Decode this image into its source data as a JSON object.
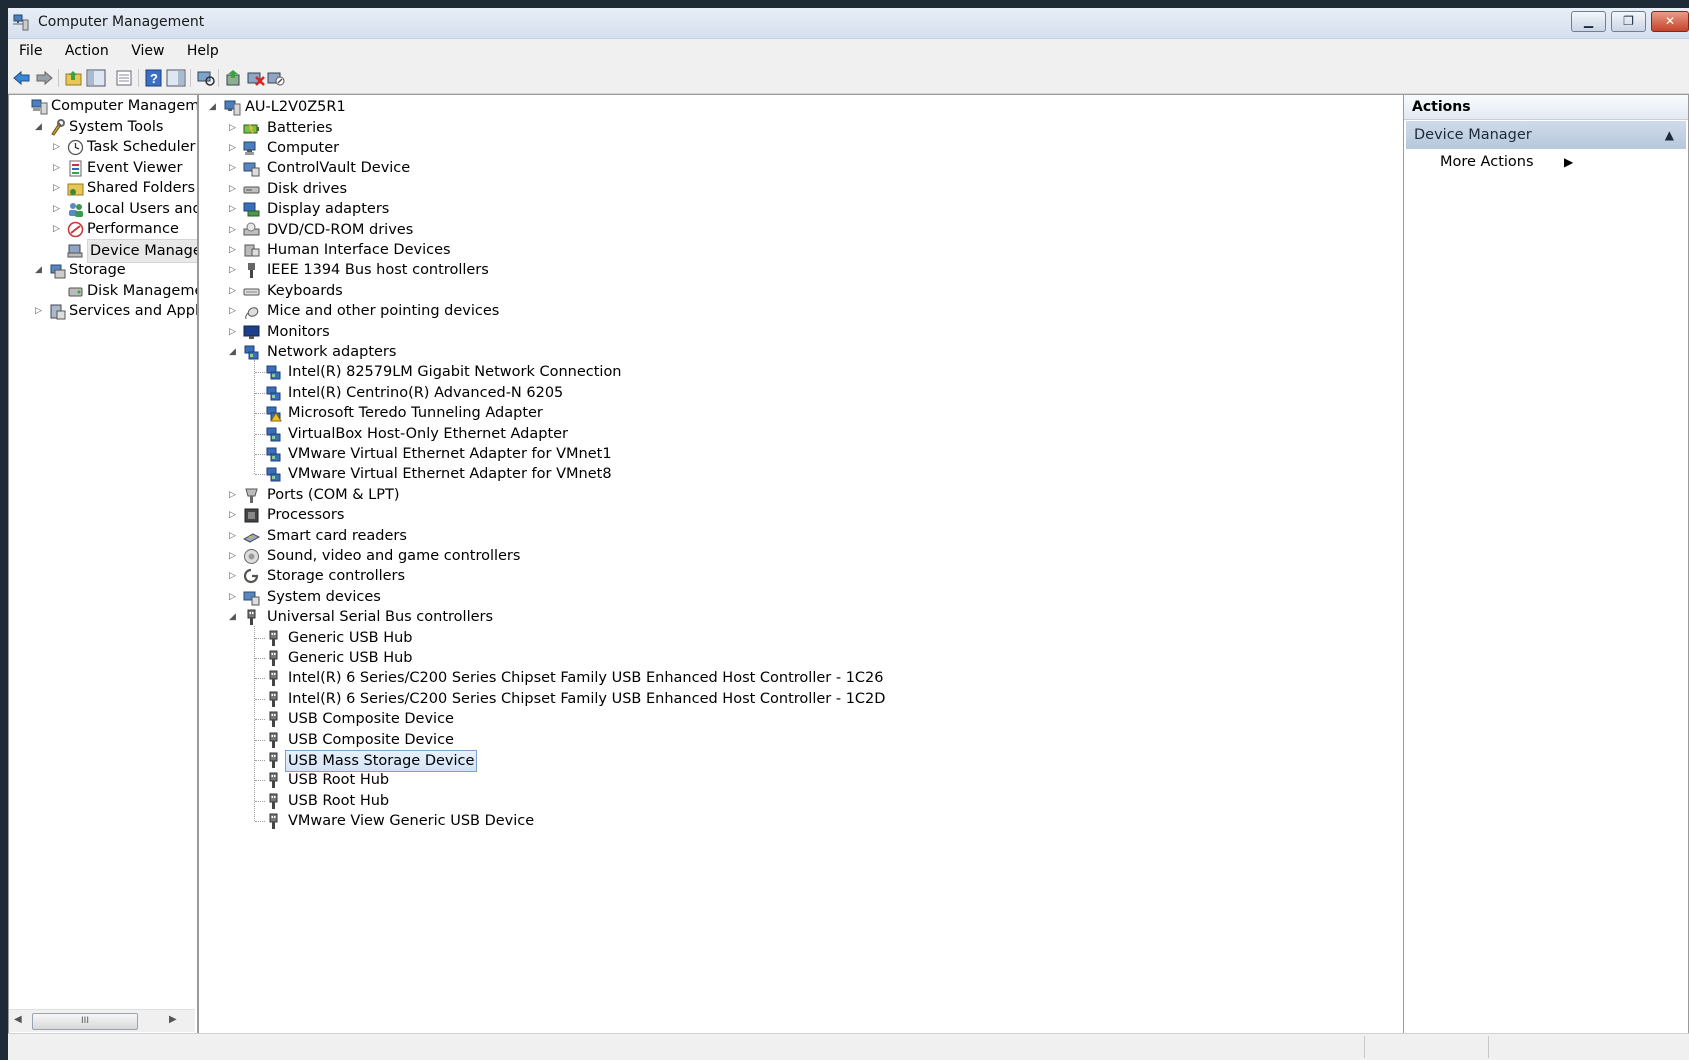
{
  "window": {
    "title": "Computer Management"
  },
  "caption_buttons": {
    "minimize": "▁",
    "restore": "❐",
    "close": "✕"
  },
  "menu": [
    "File",
    "Action",
    "View",
    "Help"
  ],
  "left_tree": [
    {
      "label": "Computer Management",
      "icon": "computer-management-icon",
      "level": 0,
      "expander": ""
    },
    {
      "label": "System Tools",
      "icon": "system-tools-icon",
      "level": 1,
      "expander": "◢"
    },
    {
      "label": "Task Scheduler",
      "icon": "clock-icon",
      "level": 2,
      "expander": "▷"
    },
    {
      "label": "Event Viewer",
      "icon": "event-viewer-icon",
      "level": 2,
      "expander": "▷"
    },
    {
      "label": "Shared Folders",
      "icon": "shared-folders-icon",
      "level": 2,
      "expander": "▷"
    },
    {
      "label": "Local Users and Gro",
      "icon": "users-icon",
      "level": 2,
      "expander": "▷"
    },
    {
      "label": "Performance",
      "icon": "performance-icon",
      "level": 2,
      "expander": "▷"
    },
    {
      "label": "Device Manager",
      "icon": "device-manager-icon",
      "level": 2,
      "expander": "",
      "selected": true
    },
    {
      "label": "Storage",
      "icon": "storage-icon",
      "level": 1,
      "expander": "◢"
    },
    {
      "label": "Disk Management",
      "icon": "disk-management-icon",
      "level": 2,
      "expander": ""
    },
    {
      "label": "Services and Applicat",
      "icon": "services-icon",
      "level": 1,
      "expander": "▷"
    }
  ],
  "device_tree": {
    "root": {
      "label": "AU-L2V0Z5R1",
      "icon": "computer-icon",
      "expander": "◢"
    },
    "items": [
      {
        "label": "Batteries",
        "icon": "battery-icon",
        "level": 1,
        "expander": "▷"
      },
      {
        "label": "Computer",
        "icon": "computer-icon",
        "level": 1,
        "expander": "▷"
      },
      {
        "label": "ControlVault Device",
        "icon": "controlvault-icon",
        "level": 1,
        "expander": "▷"
      },
      {
        "label": "Disk drives",
        "icon": "disk-drive-icon",
        "level": 1,
        "expander": "▷"
      },
      {
        "label": "Display adapters",
        "icon": "display-adapter-icon",
        "level": 1,
        "expander": "▷"
      },
      {
        "label": "DVD/CD-ROM drives",
        "icon": "dvd-drive-icon",
        "level": 1,
        "expander": "▷"
      },
      {
        "label": "Human Interface Devices",
        "icon": "hid-icon",
        "level": 1,
        "expander": "▷"
      },
      {
        "label": "IEEE 1394 Bus host controllers",
        "icon": "ieee1394-icon",
        "level": 1,
        "expander": "▷"
      },
      {
        "label": "Keyboards",
        "icon": "keyboard-icon",
        "level": 1,
        "expander": "▷"
      },
      {
        "label": "Mice and other pointing devices",
        "icon": "mouse-icon",
        "level": 1,
        "expander": "▷"
      },
      {
        "label": "Monitors",
        "icon": "monitor-icon",
        "level": 1,
        "expander": "▷"
      },
      {
        "label": "Network adapters",
        "icon": "network-adapter-icon",
        "level": 1,
        "expander": "◢"
      },
      {
        "label": "Intel(R) 82579LM Gigabit Network Connection",
        "icon": "network-adapter-icon",
        "level": 2,
        "expander": ""
      },
      {
        "label": "Intel(R) Centrino(R) Advanced-N 6205",
        "icon": "network-adapter-icon",
        "level": 2,
        "expander": ""
      },
      {
        "label": "Microsoft Teredo Tunneling Adapter",
        "icon": "network-adapter-warning-icon",
        "level": 2,
        "expander": ""
      },
      {
        "label": "VirtualBox Host-Only Ethernet Adapter",
        "icon": "network-adapter-icon",
        "level": 2,
        "expander": ""
      },
      {
        "label": "VMware Virtual Ethernet Adapter for VMnet1",
        "icon": "network-adapter-icon",
        "level": 2,
        "expander": ""
      },
      {
        "label": "VMware Virtual Ethernet Adapter for VMnet8",
        "icon": "network-adapter-icon",
        "level": 2,
        "expander": ""
      },
      {
        "label": "Ports (COM & LPT)",
        "icon": "port-icon",
        "level": 1,
        "expander": "▷"
      },
      {
        "label": "Processors",
        "icon": "processor-icon",
        "level": 1,
        "expander": "▷"
      },
      {
        "label": "Smart card readers",
        "icon": "smart-card-icon",
        "level": 1,
        "expander": "▷"
      },
      {
        "label": "Sound, video and game controllers",
        "icon": "sound-icon",
        "level": 1,
        "expander": "▷"
      },
      {
        "label": "Storage controllers",
        "icon": "storage-controller-icon",
        "level": 1,
        "expander": "▷"
      },
      {
        "label": "System devices",
        "icon": "system-device-icon",
        "level": 1,
        "expander": "▷"
      },
      {
        "label": "Universal Serial Bus controllers",
        "icon": "usb-icon",
        "level": 1,
        "expander": "◢"
      },
      {
        "label": "Generic USB Hub",
        "icon": "usb-icon",
        "level": 2,
        "expander": ""
      },
      {
        "label": "Generic USB Hub",
        "icon": "usb-icon",
        "level": 2,
        "expander": ""
      },
      {
        "label": "Intel(R) 6 Series/C200 Series Chipset Family USB Enhanced Host Controller - 1C26",
        "icon": "usb-icon",
        "level": 2,
        "expander": ""
      },
      {
        "label": "Intel(R) 6 Series/C200 Series Chipset Family USB Enhanced Host Controller - 1C2D",
        "icon": "usb-icon",
        "level": 2,
        "expander": ""
      },
      {
        "label": "USB Composite Device",
        "icon": "usb-icon",
        "level": 2,
        "expander": ""
      },
      {
        "label": "USB Composite Device",
        "icon": "usb-icon",
        "level": 2,
        "expander": ""
      },
      {
        "label": "USB Mass Storage Device",
        "icon": "usb-icon",
        "level": 2,
        "expander": "",
        "selected": true
      },
      {
        "label": "USB Root Hub",
        "icon": "usb-icon",
        "level": 2,
        "expander": ""
      },
      {
        "label": "USB Root Hub",
        "icon": "usb-icon",
        "level": 2,
        "expander": ""
      },
      {
        "label": "VMware View Generic USB Device",
        "icon": "usb-icon",
        "level": 2,
        "expander": ""
      }
    ]
  },
  "actions": {
    "header": "Actions",
    "section": "Device Manager",
    "section_caret": "▲",
    "more": "More Actions",
    "more_arrow": "▶"
  },
  "scrollbar": {
    "left_arrow": "◀",
    "right_arrow": "▶",
    "grip": "III"
  },
  "toolbar_icons": [
    "back-arrow-icon",
    "forward-arrow-icon",
    "up-folder-icon",
    "show-hide-tree-icon",
    "properties-icon",
    "help-icon",
    "show-hide-action-pane-icon",
    "scan-hardware-icon",
    "update-driver-icon",
    "uninstall-icon",
    "disable-device-icon"
  ]
}
